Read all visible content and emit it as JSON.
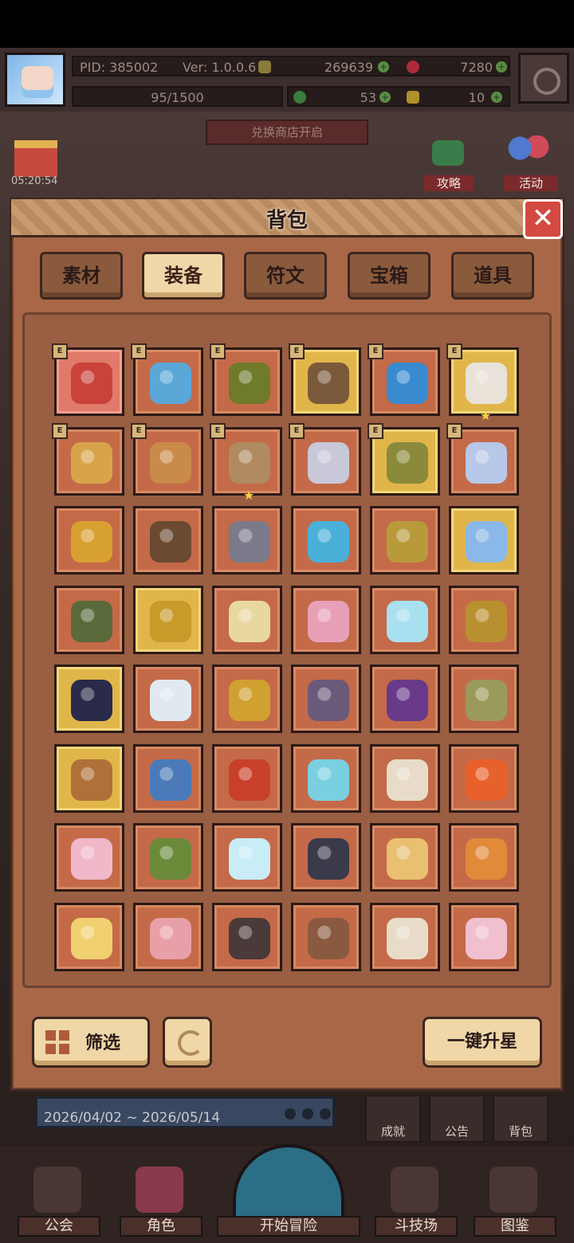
{
  "hud": {
    "pid": "PID: 385002",
    "version": "Ver: 1.0.0.6",
    "gold": "269639",
    "gems": "7280",
    "exp": "95/1500",
    "clover": "53",
    "keys": "10"
  },
  "banner": {
    "exchange": "兑换商店开启"
  },
  "timer": "05:20:54",
  "side_buttons": {
    "guide": "攻略",
    "events": "活动"
  },
  "modal": {
    "title": "背包",
    "close": "✕",
    "tabs": [
      "素材",
      "装备",
      "符文",
      "宝箱",
      "道具"
    ],
    "active_tab": "装备",
    "filter_label": "筛选",
    "upstar_label": "一键升星"
  },
  "grid": {
    "badge_text": "E",
    "items": [
      {
        "name": "pot-icon",
        "bg": "pink",
        "color": "#c9433a",
        "badge": true,
        "star": false
      },
      {
        "name": "scepter-icon",
        "bg": "normal",
        "color": "#5aa7d8",
        "badge": true,
        "star": false
      },
      {
        "name": "crown-helmet-icon",
        "bg": "normal",
        "color": "#6f7a2a",
        "badge": true,
        "star": false
      },
      {
        "name": "ornate-armor-icon",
        "bg": "gold",
        "color": "#7a5a3a",
        "badge": true,
        "star": false
      },
      {
        "name": "blue-crest-icon",
        "bg": "normal",
        "color": "#3a8ad0",
        "badge": true,
        "star": false
      },
      {
        "name": "angel-icon",
        "bg": "gold",
        "color": "#e8e2d8",
        "badge": true,
        "star": true
      },
      {
        "name": "bone-icon",
        "bg": "normal",
        "color": "#d8a44a",
        "badge": true,
        "star": false
      },
      {
        "name": "bracer-icon",
        "bg": "normal",
        "color": "#c98a4a",
        "badge": true,
        "star": false
      },
      {
        "name": "necklace-icon",
        "bg": "normal",
        "color": "#b08a60",
        "badge": true,
        "star": true
      },
      {
        "name": "silver-collar-icon",
        "bg": "normal",
        "color": "#c8c8d8",
        "badge": true,
        "star": false
      },
      {
        "name": "gold-collar-icon",
        "bg": "gold",
        "color": "#8a8a3a",
        "badge": true,
        "star": false
      },
      {
        "name": "ice-helmet-icon",
        "bg": "normal",
        "color": "#b8c8e8",
        "badge": true,
        "star": false
      },
      {
        "name": "mace-icon",
        "bg": "normal",
        "color": "#d8a030",
        "badge": false,
        "star": false
      },
      {
        "name": "staff-icon",
        "bg": "normal",
        "color": "#6a4a30",
        "badge": false,
        "star": false
      },
      {
        "name": "sword-icon",
        "bg": "normal",
        "color": "#7a7a8a",
        "badge": false,
        "star": false
      },
      {
        "name": "orb-staff-icon",
        "bg": "normal",
        "color": "#4ab0d8",
        "badge": false,
        "star": false
      },
      {
        "name": "spear-icon",
        "bg": "normal",
        "color": "#b89a3a",
        "badge": false,
        "star": false
      },
      {
        "name": "crystal-helmet-icon",
        "bg": "gold",
        "color": "#8ab8e8",
        "badge": false,
        "star": false
      },
      {
        "name": "green-helmet-icon",
        "bg": "normal",
        "color": "#5a6a3a",
        "badge": false,
        "star": false
      },
      {
        "name": "gold-ring-icon",
        "bg": "gold",
        "color": "#c89a2a",
        "badge": false,
        "star": false
      },
      {
        "name": "skull-mask-icon",
        "bg": "normal",
        "color": "#e8d8a0",
        "badge": false,
        "star": false
      },
      {
        "name": "pink-robe-icon",
        "bg": "normal",
        "color": "#e8a0b8",
        "badge": false,
        "star": false
      },
      {
        "name": "ice-robe-icon",
        "bg": "normal",
        "color": "#a8e0f0",
        "badge": false,
        "star": false
      },
      {
        "name": "gold-armor-icon",
        "bg": "normal",
        "color": "#b89030",
        "badge": false,
        "star": false
      },
      {
        "name": "flower-glove-icon",
        "bg": "gold",
        "color": "#2a2a4a",
        "badge": false,
        "star": false
      },
      {
        "name": "white-glove-icon",
        "bg": "normal",
        "color": "#e0e8f0",
        "badge": false,
        "star": false
      },
      {
        "name": "ruby-ring-icon",
        "bg": "normal",
        "color": "#d0a030",
        "badge": false,
        "star": false
      },
      {
        "name": "rose-ring-icon",
        "bg": "normal",
        "color": "#6a5a7a",
        "badge": false,
        "star": false
      },
      {
        "name": "violet-ring-icon",
        "bg": "normal",
        "color": "#6a3a8a",
        "badge": false,
        "star": false
      },
      {
        "name": "jade-ring-icon",
        "bg": "normal",
        "color": "#9a9a5a",
        "badge": false,
        "star": false
      },
      {
        "name": "bronze-ring-icon",
        "bg": "gold",
        "color": "#b0703a",
        "badge": false,
        "star": false
      },
      {
        "name": "blue-gloves-icon",
        "bg": "normal",
        "color": "#4a7ab8",
        "badge": false,
        "star": false
      },
      {
        "name": "fire-cape-icon",
        "bg": "normal",
        "color": "#c8402a",
        "badge": false,
        "star": false
      },
      {
        "name": "ice-boots-icon",
        "bg": "normal",
        "color": "#7ad0e0",
        "badge": false,
        "star": false
      },
      {
        "name": "cloth-boots-icon",
        "bg": "normal",
        "color": "#e8dcc8",
        "badge": false,
        "star": false
      },
      {
        "name": "fire-gem-icon",
        "bg": "normal",
        "color": "#e8602a",
        "badge": false,
        "star": false
      },
      {
        "name": "pink-shell-icon",
        "bg": "normal",
        "color": "#f0b8c8",
        "badge": false,
        "star": false
      },
      {
        "name": "green-wreath-icon",
        "bg": "normal",
        "color": "#6a8a3a",
        "badge": false,
        "star": false
      },
      {
        "name": "ice-shell-icon",
        "bg": "normal",
        "color": "#c8ecf8",
        "badge": false,
        "star": false
      },
      {
        "name": "dark-amulet-icon",
        "bg": "normal",
        "color": "#3a3a4a",
        "badge": false,
        "star": false
      },
      {
        "name": "sun-amulet-icon",
        "bg": "normal",
        "color": "#e8c070",
        "badge": false,
        "star": false
      },
      {
        "name": "orange-amulet-icon",
        "bg": "normal",
        "color": "#e08a3a",
        "badge": false,
        "star": false
      },
      {
        "name": "sword-crest-icon",
        "bg": "normal",
        "color": "#f0d070",
        "badge": false,
        "star": false
      },
      {
        "name": "heart-pendant-icon",
        "bg": "normal",
        "color": "#e8a0a8",
        "badge": false,
        "star": false
      },
      {
        "name": "gem-pendant-icon",
        "bg": "normal",
        "color": "#4a3a3a",
        "badge": false,
        "star": false
      },
      {
        "name": "brown-pendant-icon",
        "bg": "normal",
        "color": "#8a5a40",
        "badge": false,
        "star": false
      },
      {
        "name": "fur-collar-icon",
        "bg": "normal",
        "color": "#e8dcc8",
        "badge": false,
        "star": false
      },
      {
        "name": "winged-heart-icon",
        "bg": "normal",
        "color": "#f0c0d0",
        "badge": false,
        "star": false
      }
    ]
  },
  "bottom": {
    "date_range": "2026/04/02 ~ 2026/05/14",
    "side": [
      "成就",
      "公告",
      "背包"
    ],
    "nav": [
      "公会",
      "角色",
      "开始冒险",
      "斗技场",
      "图鉴"
    ]
  },
  "colors": {
    "panel": "#a86848",
    "cell": "#c46a48",
    "cell_gold": "#e0b64a",
    "close": "#d44a40",
    "tab_active": "#f0d7a8"
  }
}
